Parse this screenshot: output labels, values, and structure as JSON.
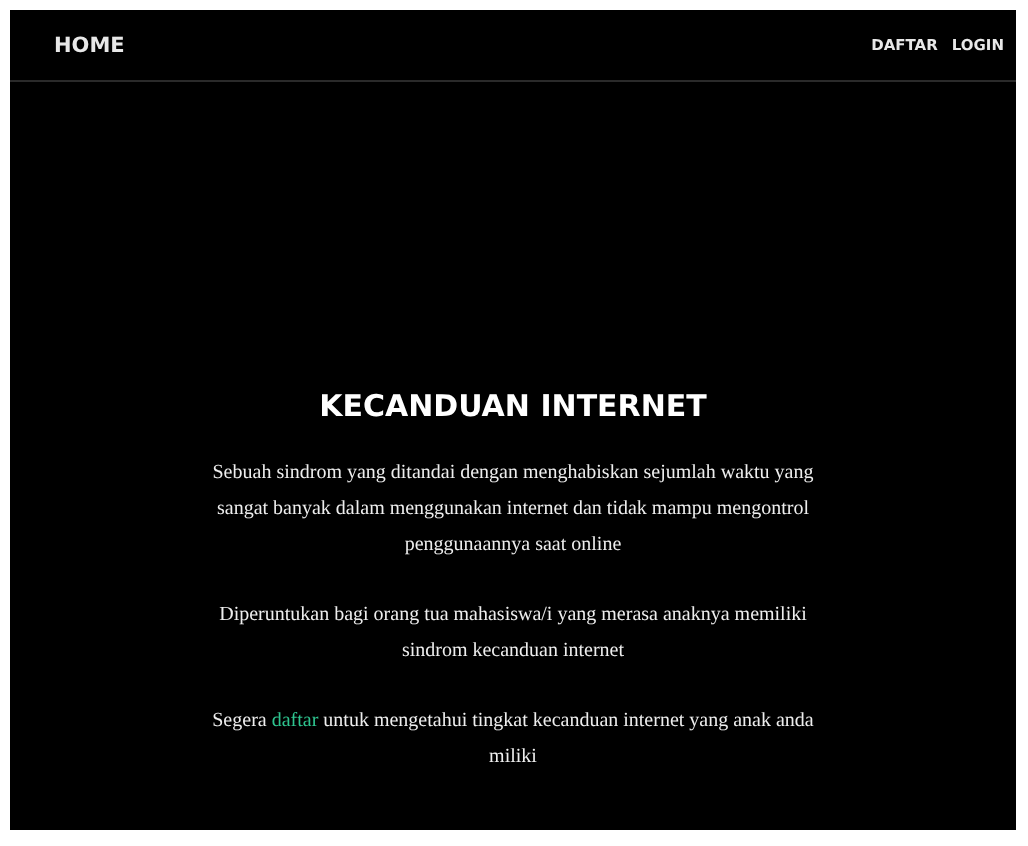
{
  "navbar": {
    "brand": "HOME",
    "links": [
      "DAFTAR",
      "LOGIN"
    ]
  },
  "hero": {
    "title": "KECANDUAN INTERNET",
    "paragraphs": [
      "Sebuah sindrom yang ditandai dengan menghabiskan sejumlah waktu yang sangat banyak dalam menggunakan internet dan tidak mampu mengontrol penggunaannya saat online",
      "Diperuntukan bagi orang tua mahasiswa/i yang merasa anaknya memiliki sindrom kecanduan internet"
    ],
    "call_to_action": {
      "text_before": "Segera",
      "link": "daftar",
      "text_after": "untuk mengetahui tingkat kecanduan internet yang anak anda miliki"
    }
  }
}
